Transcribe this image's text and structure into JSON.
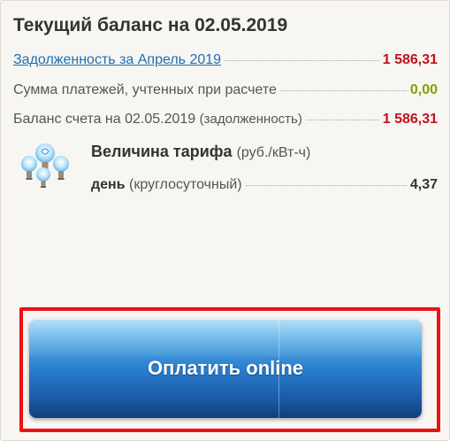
{
  "balance": {
    "title": "Текущий баланс на 02.05.2019",
    "debt_row": {
      "label": "Задолженность за Апрель 2019",
      "value": "1 586,31"
    },
    "payments_row": {
      "label": "Сумма платежей, учтенных при расчете",
      "value": "0,00"
    },
    "account_row": {
      "label": "Баланс счета на 02.05.2019",
      "note": "(задолженность)",
      "value": "1 586,31"
    }
  },
  "tariff": {
    "icon": "light-bulbs-icon",
    "title": "Величина тарифа",
    "unit": "(руб./кВт-ч)",
    "day_label": "день",
    "day_note": "(круглосуточный)",
    "day_value": "4,37"
  },
  "actions": {
    "pay_online_label": "Оплатить online"
  },
  "colors": {
    "negative": "#c0141b",
    "positive": "#7da300",
    "link": "#1f6fb2",
    "highlight": "#ee1111",
    "button": "#2b7fcf"
  }
}
